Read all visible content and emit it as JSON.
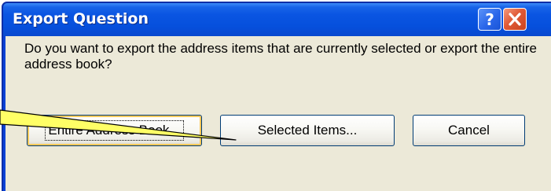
{
  "dialog": {
    "title": "Export Question",
    "message": "Do you want to export the address items that are currently selected or export the entire address book?",
    "title_buttons": {
      "help_icon": "question-mark-icon",
      "close_icon": "close-x-icon"
    }
  },
  "buttons": {
    "entire": "Entire Address Book...",
    "selected": "Selected Items...",
    "cancel": "Cancel"
  },
  "colors": {
    "titlebar": "#0650dc",
    "dialog_background": "#ece9d8",
    "callout_fill": "#ffff66",
    "close_button": "#e05a36"
  }
}
